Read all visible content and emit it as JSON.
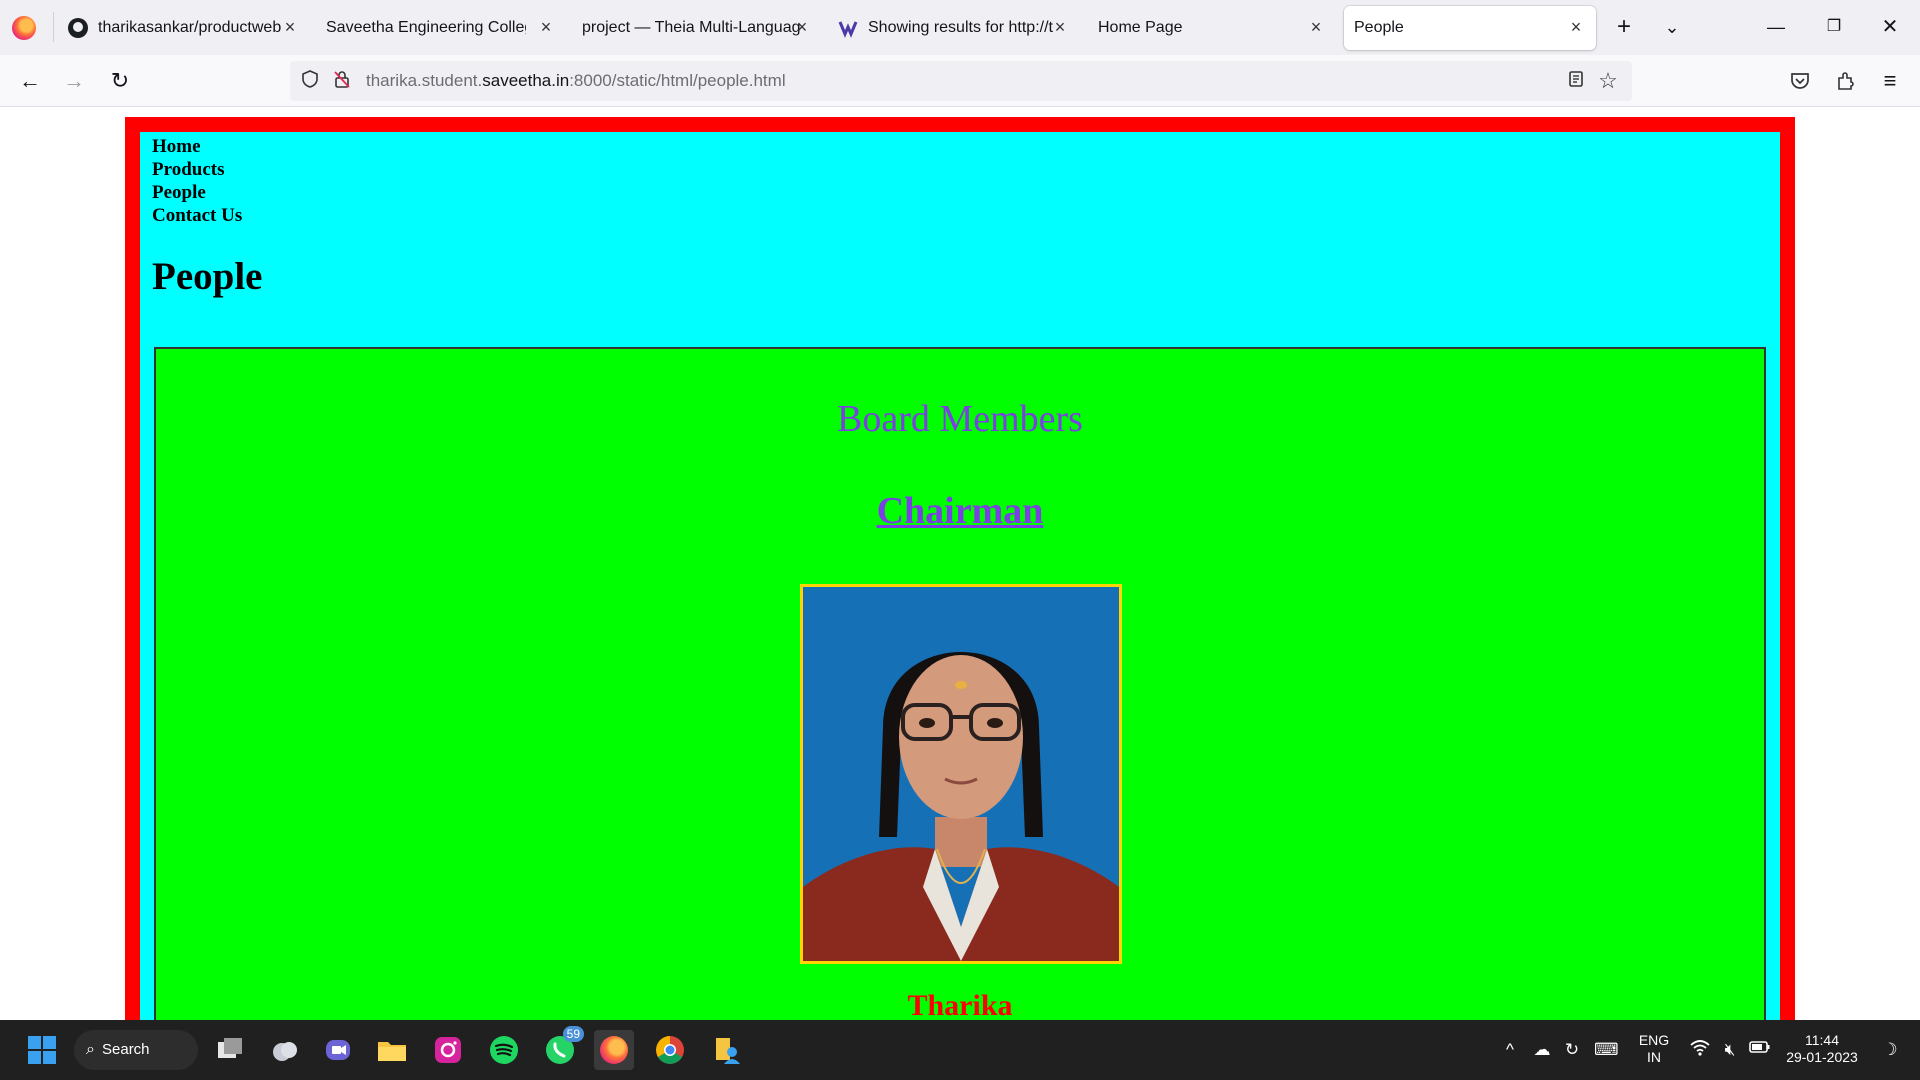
{
  "browser": {
    "tabs": [
      {
        "title": "tharikasankar/productweb",
        "icon": "github-icon"
      },
      {
        "title": "Saveetha Engineering College",
        "icon": "none"
      },
      {
        "title": "project — Theia Multi-Language",
        "icon": "none"
      },
      {
        "title": "Showing results for http://th",
        "icon": "wappalyzer-icon"
      },
      {
        "title": "Home Page",
        "icon": "none"
      },
      {
        "title": "People",
        "icon": "none",
        "active": true
      }
    ],
    "url": {
      "prefix": "tharika.student.",
      "domain": "saveetha.in",
      "suffix": ":8000/static/html/people.html"
    }
  },
  "page": {
    "nav": [
      "Home",
      "Products",
      "People",
      "Contact Us"
    ],
    "title": "People",
    "board_heading": "Board Members",
    "chairman_heading": "Chairman",
    "person_name": "Tharika",
    "colors": {
      "outer_border": "#ff0000",
      "inner_bg": "#00ffff",
      "content_bg": "#00ff00",
      "heading_color": "#7b3fe4",
      "name_color": "#ff0000",
      "photo_border": "#ffd400"
    }
  },
  "taskbar": {
    "search_label": "Search",
    "whatsapp_badge": "59",
    "language": "ENG",
    "region": "IN",
    "time": "11:44",
    "date": "29-01-2023"
  }
}
